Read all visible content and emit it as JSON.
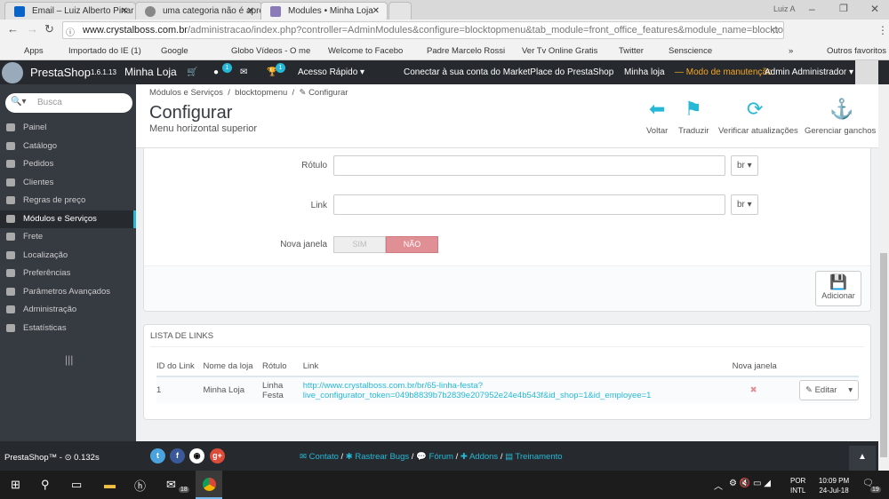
{
  "browser": {
    "tabs": [
      {
        "title": "Email – Luiz Alberto Pinar"
      },
      {
        "title": "uma categoria não é apre"
      },
      {
        "title": "Modules • Minha Loja"
      }
    ],
    "user": "Luiz A",
    "url_host": "www.crystalboss.com.br",
    "url_path": "/administracao/index.php?controller=AdminModules&configure=blocktopmenu&tab_module=front_office_features&module_name=blockto...",
    "bookmarks": [
      "Apps",
      "Importado do IE (1)",
      "Google",
      "Globo Vídeos - O me",
      "Welcome to Facebo",
      "Padre Marcelo Rossi",
      "Ver Tv Online Gratis",
      "Twitter",
      "Senscience",
      "»",
      "Outros favoritos"
    ]
  },
  "topbar": {
    "brand": "PrestaShop",
    "version": "1.6.1.13",
    "shop": "Minha Loja",
    "customers_badge": "1",
    "trophy_badge": "1",
    "quick_access": "Acesso Rápido ▾",
    "marketplace": "Conectar à sua conta do MarketPlace do PrestaShop",
    "shop_name": "Minha loja",
    "maintenance": "— Modo de manutenção",
    "admin": "Admin Administrador ▾"
  },
  "sidebar": {
    "search_placeholder": "Busca",
    "items": [
      "Painel",
      "Catálogo",
      "Pedidos",
      "Clientes",
      "Regras de preço",
      "Módulos e Serviços",
      "Frete",
      "Localização",
      "Preferências",
      "Parâmetros Avançados",
      "Administração",
      "Estatísticas"
    ]
  },
  "header": {
    "breadcrumb": [
      "Módulos e Serviços",
      "/",
      "blocktopmenu",
      "/",
      "✎ Configurar"
    ],
    "title": "Configurar",
    "subtitle": "Menu horizontal superior",
    "toolbar": [
      "Voltar",
      "Traduzir",
      "Verificar atualizações",
      "Gerenciar ganchos"
    ]
  },
  "form": {
    "label_rotulo": "Rótulo",
    "label_link": "Link",
    "lang": "br ▾",
    "label_new_window": "Nova janela",
    "yes": "SIM",
    "no": "NÃO",
    "add": "Adicionar"
  },
  "links": {
    "title": "LISTA DE LINKS",
    "columns": [
      "ID do Link",
      "Nome da loja",
      "Rótulo",
      "Link",
      "Nova janela"
    ],
    "rows": [
      {
        "id": "1",
        "shop": "Minha Loja",
        "label1": "Linha",
        "label2": "Festa",
        "link1": "http://www.crystalboss.com.br/br/65-linha-festa?",
        "link2": "live_configurator_token=049b8839b7b2839e207952e24e4b543f&id_shop=1&id_employee=1",
        "new_window": "✖",
        "edit": "✎ Editar"
      }
    ]
  },
  "footer": {
    "left": "PrestaShop™ - ⊙ 0.132s",
    "links": [
      "✉ Contato",
      "/",
      "✱ Rastrear Bugs",
      "/",
      "💬 Fórum",
      "/",
      "✚ Addons",
      "/",
      "▤ Treinamento"
    ]
  },
  "taskbar": {
    "lang1": "POR",
    "lang2": "INTL",
    "time": "10:09 PM",
    "date": "24-Jul-18",
    "notif": "19",
    "mail_badge": "18"
  }
}
